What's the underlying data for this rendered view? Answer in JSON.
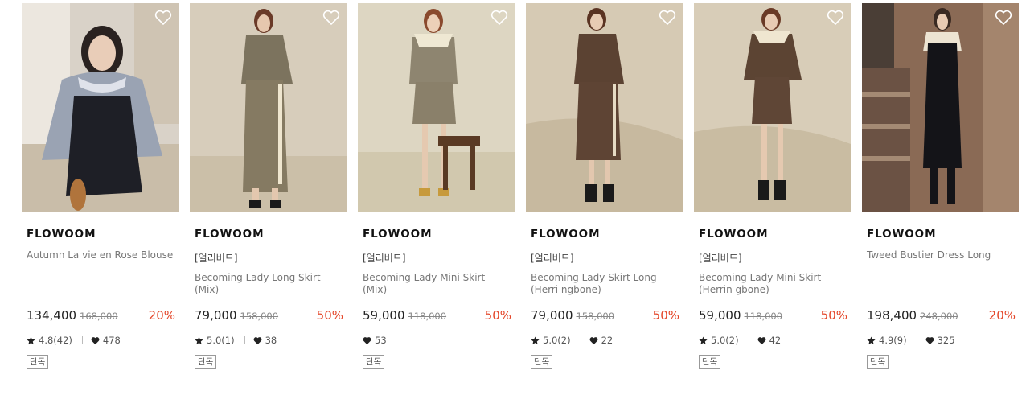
{
  "accent": "#e44528",
  "products": [
    {
      "brand": "FLOWOOM",
      "tag": "",
      "name": "Autumn La vie en Rose Blouse",
      "price": "134,400",
      "original_price": "168,000",
      "discount": "20%",
      "rating": "4.8(42)",
      "likes": "478",
      "badge": "단독",
      "icon": "heart-outline-icon"
    },
    {
      "brand": "FLOWOOM",
      "tag": "[얼리버드]",
      "name": "Becoming Lady Long Skirt (Mix)",
      "price": "79,000",
      "original_price": "158,000",
      "discount": "50%",
      "rating": "5.0(1)",
      "likes": "38",
      "badge": "단독",
      "icon": "heart-outline-icon"
    },
    {
      "brand": "FLOWOOM",
      "tag": "[얼리버드]",
      "name": "Becoming Lady Mini Skirt (Mix)",
      "price": "59,000",
      "original_price": "118,000",
      "discount": "50%",
      "rating": "",
      "likes": "53",
      "badge": "단독",
      "icon": "heart-outline-icon"
    },
    {
      "brand": "FLOWOOM",
      "tag": "[얼리버드]",
      "name": "Becoming Lady Skirt Long (Herri ngbone)",
      "price": "79,000",
      "original_price": "158,000",
      "discount": "50%",
      "rating": "5.0(2)",
      "likes": "22",
      "badge": "단독",
      "icon": "heart-outline-icon"
    },
    {
      "brand": "FLOWOOM",
      "tag": "[얼리버드]",
      "name": "Becoming Lady Mini Skirt (Herrin gbone)",
      "price": "59,000",
      "original_price": "118,000",
      "discount": "50%",
      "rating": "5.0(2)",
      "likes": "42",
      "badge": "단독",
      "icon": "heart-outline-icon"
    },
    {
      "brand": "FLOWOOM",
      "tag": "",
      "name": "Tweed Bustier Dress Long",
      "price": "198,400",
      "original_price": "248,000",
      "discount": "20%",
      "rating": "4.9(9)",
      "likes": "325",
      "badge": "단독",
      "icon": "heart-outline-icon"
    }
  ]
}
